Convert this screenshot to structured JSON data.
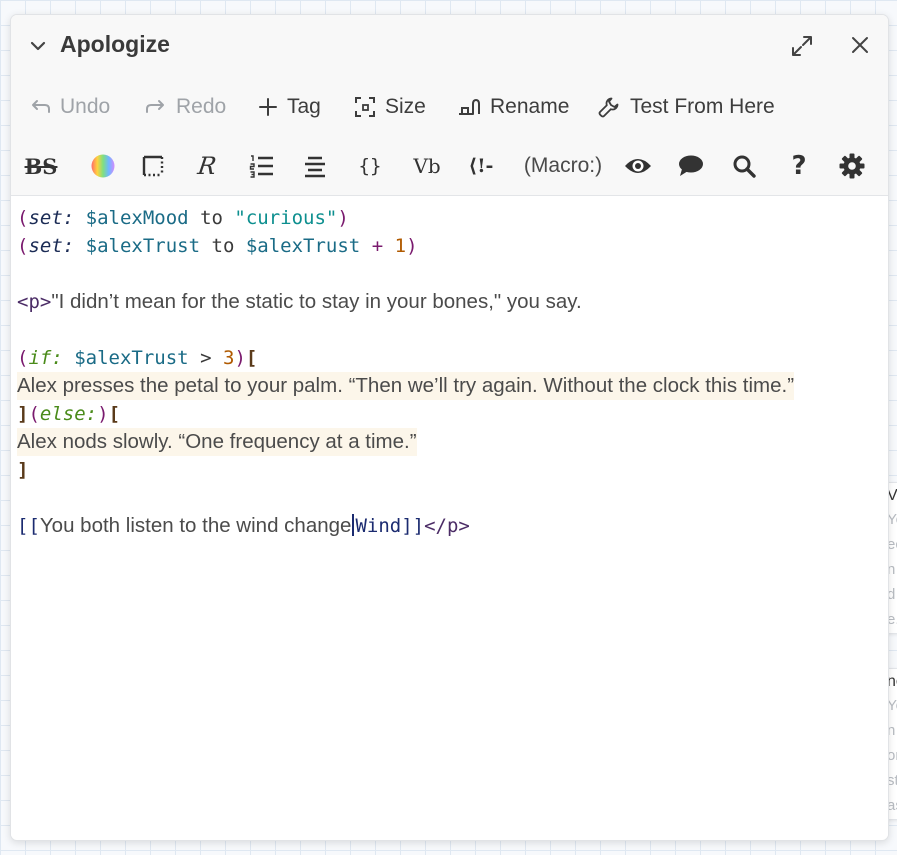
{
  "background_passages": [
    {
      "title": "V",
      "lines": [
        "Yo",
        "ec",
        "n",
        "d",
        "e."
      ]
    },
    {
      "title": "ne",
      "lines": [
        "Yo",
        "n",
        "or",
        "st",
        "as"
      ]
    }
  ],
  "dialog": {
    "title": "Apologize",
    "icons": {
      "collapse": "chevron-down-icon",
      "maximize": "maximize-icon",
      "close": "close-icon"
    }
  },
  "actions": {
    "undo": "Undo",
    "redo": "Redo",
    "tag": "Tag",
    "size": "Size",
    "rename": "Rename",
    "test_from_here": "Test From Here"
  },
  "toolbar": {
    "bold_strike": "BS",
    "colour": "rainbow-palette-icon",
    "border": "dotted-border-icon",
    "special_font": "R",
    "list": "numbered-list-icon",
    "align": "align-center-icon",
    "braces": "{}",
    "verbatim": "Vb",
    "comment": "⟨!-",
    "macro": "(Macro:)",
    "preview": "eye-icon",
    "speech": "speech-bubble-icon",
    "find": "search-icon",
    "help": "?",
    "settings": "gear-icon"
  },
  "code": {
    "line1": {
      "open": "(",
      "macro": "set:",
      "var": "$alexMood",
      "to": "to",
      "str": "\"curious\"",
      "close": ")"
    },
    "line2": {
      "open": "(",
      "macro": "set:",
      "var": "$alexTrust",
      "to": "to",
      "var2": "$alexTrust",
      "plus": "+",
      "num": "1",
      "close": ")"
    },
    "line3": {
      "tag": "<p>",
      "text": "\"I didn’t mean for the static to stay in your bones,\" you say."
    },
    "line4": {
      "open": "(",
      "macro": "if:",
      "var": "$alexTrust",
      "op": ">",
      "num": "3",
      "close": ")",
      "hook": "["
    },
    "line5": {
      "text": "Alex presses the petal to your palm. “Then we’ll try again. Without the clock this time.”"
    },
    "line6": {
      "hook_close": "]",
      "open": "(",
      "macro": "else:",
      "close": ")",
      "hook": "["
    },
    "line7": {
      "text": "Alex nods slowly. “One frequency at a time.”"
    },
    "line8": {
      "hook_close": "]"
    },
    "line9": {
      "open": "[[",
      "text": "You both listen to the wind change",
      "target": "Wind",
      "close": "]]",
      "end_tag": "</p>"
    }
  }
}
